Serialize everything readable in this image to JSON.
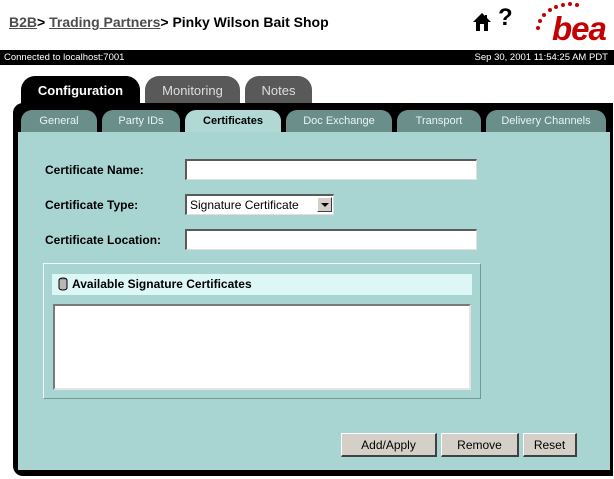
{
  "header": {
    "crumb_b2b": "B2B",
    "crumb_sep1": ">",
    "crumb_trading": "Trading Partners",
    "crumb_sep2": ">",
    "crumb_current": "Pinky Wilson Bait Shop",
    "help_glyph": "?",
    "logo_text": "bea"
  },
  "status": {
    "connection": "Connected to localhost:7001",
    "datetime": "Sep 30, 2001 11:54:25 AM PDT"
  },
  "top_tabs": [
    {
      "label": "Configuration",
      "active": true
    },
    {
      "label": "Monitoring",
      "active": false
    },
    {
      "label": "Notes",
      "active": false
    }
  ],
  "sub_tabs": [
    {
      "label": "General",
      "active": false
    },
    {
      "label": "Party IDs",
      "active": false
    },
    {
      "label": "Certificates",
      "active": true
    },
    {
      "label": "Doc Exchange",
      "active": false
    },
    {
      "label": "Transport",
      "active": false
    },
    {
      "label": "Delivery Channels",
      "active": false
    }
  ],
  "form": {
    "cert_name_label": "Certificate Name:",
    "cert_name_value": "",
    "cert_type_label": "Certificate Type:",
    "cert_type_value": "Signature Certificate",
    "cert_location_label": "Certificate Location:",
    "cert_location_value": ""
  },
  "available": {
    "title": "Available Signature Certificates",
    "items": []
  },
  "buttons": {
    "add_apply": "Add/Apply",
    "remove": "Remove",
    "reset": "Reset"
  },
  "colors": {
    "panel": "#a8d4d1",
    "active_subtab": "#b0d8d4",
    "inactive_subtab": "#6a8f8b",
    "logo_red": "#c40000"
  }
}
